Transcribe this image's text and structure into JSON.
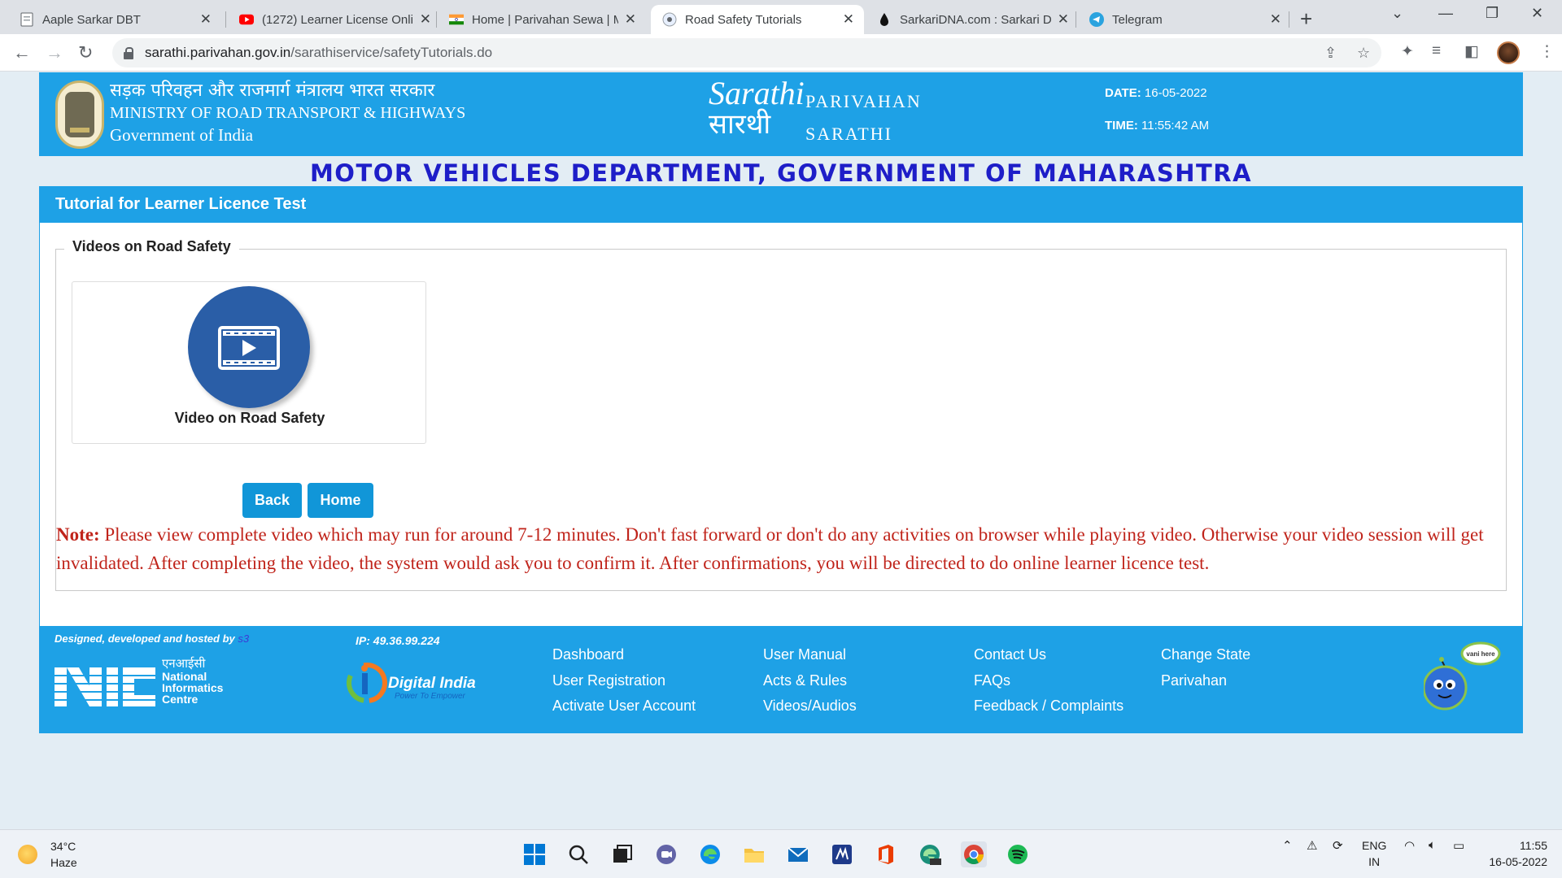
{
  "browser": {
    "tabs": [
      {
        "title": "Aaple Sarkar DBT",
        "icon": "page-icon"
      },
      {
        "title": "(1272) Learner License Onli",
        "icon": "youtube-icon"
      },
      {
        "title": "Home | Parivahan Sewa | M",
        "icon": "india-flag-icon"
      },
      {
        "title": "Road Safety Tutorials",
        "icon": "parivahan-icon"
      },
      {
        "title": "SarkariDNA.com : Sarkari D",
        "icon": "sarkaridna-icon"
      },
      {
        "title": "Telegram",
        "icon": "telegram-icon"
      }
    ],
    "active_tab": 3,
    "url_host": "sarathi.parivahan.gov.in",
    "url_path": "/sarathiservice/safetyTutorials.do"
  },
  "header": {
    "ministry_hindi": "सड़क परिवहन और राजमार्ग मंत्रालय भारत सरकार",
    "ministry_english": "MINISTRY OF ROAD TRANSPORT & HIGHWAYS",
    "government": "Government of India",
    "logo_en": "Sarathi",
    "logo_hi": "सारथी",
    "brand_line1": "PARIVAHAN",
    "brand_line2": "SARATHI",
    "date_label": "DATE:",
    "date_value": "16-05-2022",
    "time_label": "TIME:",
    "time_value": "11:55:42 AM"
  },
  "department_title": "MOTOR VEHICLES DEPARTMENT, GOVERNMENT OF MAHARASHTRA",
  "panel": {
    "title": "Tutorial for Learner Licence Test",
    "section_legend": "Videos on Road Safety",
    "video_label": "Video on Road Safety",
    "back_button": "Back",
    "home_button": "Home",
    "note_label": "Note:",
    "note_text": "Please view complete video which may run for around 7-12 minutes. Don't fast forward or don't do any activities on browser while playing video. Otherwise your video session will get invalidated. After completing the video, the system would ask you to confirm it. After confirmations, you will be directed to do online learner licence test."
  },
  "footer": {
    "designed_by": "Designed, developed and hosted by",
    "designed_by_link": "s3",
    "nic_hindi": "एनआईसी",
    "nic_line1": "National",
    "nic_line2": "Informatics",
    "nic_line3": "Centre",
    "ip": "IP: 49.36.99.224",
    "digital_india": "Digital India",
    "digital_india_tagline": "Power To Empower",
    "links_col1": [
      "Dashboard",
      "User Registration",
      "Activate User Account"
    ],
    "links_col2": [
      "User Manual",
      "Acts & Rules",
      "Videos/Audios"
    ],
    "links_col3": [
      "Contact Us",
      "FAQs",
      "Feedback / Complaints"
    ],
    "links_col4": [
      "Change State",
      "Parivahan"
    ],
    "mascot_bubble": "vani here"
  },
  "taskbar": {
    "temperature": "34°C",
    "weather": "Haze",
    "language": "ENG",
    "region": "IN",
    "time": "11:55",
    "date": "16-05-2022"
  },
  "colors": {
    "brand_blue": "#1ea1e6",
    "dept_title": "#1e1ec8",
    "note_red": "#c0241b",
    "button_blue": "#1196d8"
  }
}
